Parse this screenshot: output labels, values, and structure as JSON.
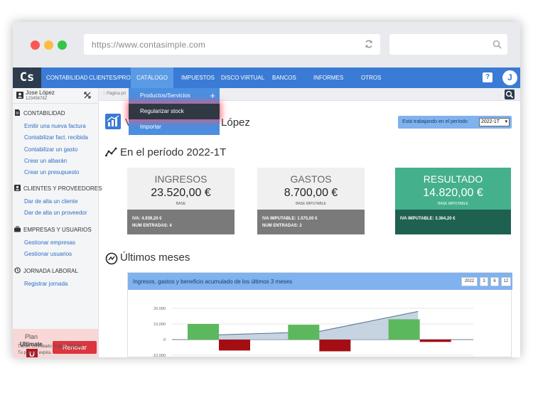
{
  "browser": {
    "url": "https://www.contasimple.com"
  },
  "nav": {
    "logo": "Cs",
    "items": [
      {
        "label": "CONTABILIDAD"
      },
      {
        "label": "CLIENTES/PROV."
      },
      {
        "label": "CATÁLOGO",
        "active": true
      },
      {
        "label": "IMPUESTOS"
      },
      {
        "label": "DISCO VIRTUAL"
      },
      {
        "label": "BANCOS"
      },
      {
        "label": "INFORMES"
      },
      {
        "label": "OTROS"
      }
    ],
    "help": "?",
    "avatar": "J"
  },
  "dropdown": {
    "items": [
      {
        "label": "Productos/Servicios",
        "icon": "plus-icon"
      },
      {
        "label": "Regularizar stock",
        "highlighted": true
      },
      {
        "label": "Importar"
      }
    ]
  },
  "sidebar": {
    "user": {
      "name": "Jose López",
      "id": "12345678Z"
    },
    "sections": [
      {
        "title": "CONTABILIDAD",
        "icon": "document-icon",
        "links": [
          "Emitir una nueva factura",
          "Contabilizar fact. recibida",
          "Contabilizar un gasto",
          "Crear un albarán",
          "Crear un presupuesto"
        ]
      },
      {
        "title": "CLIENTES Y PROVEEDORES",
        "icon": "contacts-icon",
        "links": [
          "Dar de alta un cliente",
          "Dar de alta un proveedor"
        ]
      },
      {
        "title": "EMPRESAS Y USUARIOS",
        "icon": "briefcase-icon",
        "links": [
          "Gestionar empresas",
          "Gestionar usuarios"
        ]
      },
      {
        "title": "JORNADA LABORAL",
        "icon": "history-icon",
        "links": [
          "Registrar jornada"
        ]
      }
    ],
    "plan": {
      "title": "Plan",
      "name": "Ultimate",
      "badge": "U",
      "renew": "Renovar"
    },
    "plan_footer_1": "Tienes contratado el plan Ultimate.",
    "plan_footer_2": "Tu plan no expira."
  },
  "main": {
    "breadcrumb": ":: Página pri",
    "welcome": "V",
    "welcome_tail": "se López",
    "period_label": "Está trabajando en el período",
    "period_value": "2022-1T",
    "section_period": "En el período 2022-1T",
    "section_months": "Últimos meses",
    "cards": [
      {
        "label": "INGRESOS",
        "value": "23.520,00 €",
        "sub": "BASE",
        "line1": "IVA: 4.939,20 €",
        "line2": "NUM ENTRADAS: 4"
      },
      {
        "label": "GASTOS",
        "value": "8.700,00 €",
        "sub": "BASE IMPUTABLE",
        "line1": "IVA IMPUTABLE: 1.575,00 €",
        "line2": "NUM ENTRADAS: 2"
      },
      {
        "label": "RESULTADO",
        "value": "14.820,00 €",
        "sub": "BASE IMPUTABLE",
        "line1": "IVA IMPUTABLE: 3.364,20 €",
        "line2": ""
      }
    ]
  },
  "chart_data": {
    "type": "bar",
    "title": "Ingresos, gastos y beneficio acumulado de los últimos 3 meses",
    "range_buttons": [
      "2022",
      "3",
      "6",
      "12"
    ],
    "categories": [
      "",
      "",
      ""
    ],
    "series": [
      {
        "values": [
          10000,
          9500,
          13000
        ],
        "color": "#5cb85c"
      },
      {
        "values": [
          -7000,
          -7500,
          -1500
        ],
        "color": "#a50d14"
      },
      {
        "type": "area",
        "values": [
          3000,
          5000,
          18000
        ],
        "color": "#b3c6d8"
      }
    ],
    "yticks": [
      "20,000",
      "10,000",
      "0",
      "-10,000"
    ],
    "ylim": [
      -12000,
      22000
    ]
  }
}
